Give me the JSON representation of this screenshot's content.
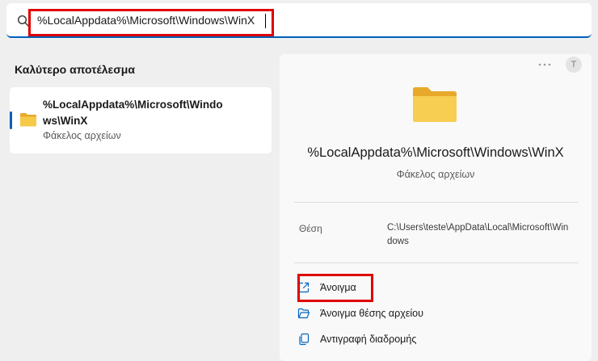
{
  "search": {
    "value": "%LocalAppdata%\\Microsoft\\Windows\\WinX"
  },
  "best_match": {
    "heading": "Καλύτερο αποτέλεσμα",
    "title": "%LocalAppdata%\\Microsoft\\Windows\\WinX",
    "subtitle": "Φάκελος αρχείων"
  },
  "details": {
    "avatar_letter": "T",
    "title": "%LocalAppdata%\\Microsoft\\Windows\\WinX",
    "subtitle": "Φάκελος αρχείων",
    "location_label": "Θέση",
    "location_value": "C:\\Users\\teste\\AppData\\Local\\Microsoft\\Windows"
  },
  "actions": [
    {
      "label": "Άνοιγμα",
      "icon": "open-external-icon"
    },
    {
      "label": "Άνοιγμα θέσης αρχείου",
      "icon": "folder-open-icon"
    },
    {
      "label": "Αντιγραφή διαδρομής",
      "icon": "copy-icon"
    }
  ],
  "colors": {
    "accent": "#005fb8",
    "highlight": "#e00000",
    "folder": "#f5c242"
  }
}
